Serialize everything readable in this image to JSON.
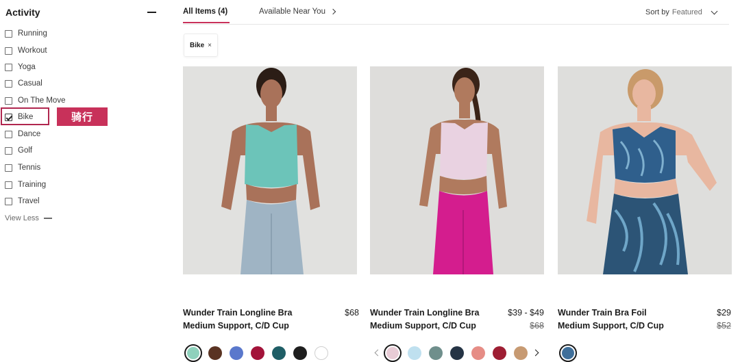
{
  "sidebar": {
    "title": "Activity",
    "filters": [
      {
        "label": "Running",
        "checked": false
      },
      {
        "label": "Workout",
        "checked": false
      },
      {
        "label": "Yoga",
        "checked": false
      },
      {
        "label": "Casual",
        "checked": false
      },
      {
        "label": "On The Move",
        "checked": false
      },
      {
        "label": "Bike",
        "checked": true
      },
      {
        "label": "Dance",
        "checked": false
      },
      {
        "label": "Golf",
        "checked": false
      },
      {
        "label": "Tennis",
        "checked": false
      },
      {
        "label": "Training",
        "checked": false
      },
      {
        "label": "Travel",
        "checked": false
      }
    ],
    "view_less": "View Less",
    "annotation": "骑行"
  },
  "tabs": {
    "all_items": "All Items (4)",
    "available_near": "Available Near You"
  },
  "sort": {
    "label": "Sort by",
    "value": "Featured"
  },
  "applied_filter": {
    "label": "Bike",
    "remove_icon": "×"
  },
  "products": [
    {
      "name_line1": "Wunder Train Longline Bra",
      "name_line2": "Medium Support, C/D Cup",
      "price": "$68",
      "old_price": "",
      "swatches": [
        "#8fd1bc",
        "#5a3322",
        "#5a78cc",
        "#a3133a",
        "#1f5e66",
        "#1e1e1e",
        "#ffffff"
      ]
    },
    {
      "name_line1": "Wunder Train Longline Bra",
      "name_line2": "Medium Support, C/D Cup",
      "price": "$39 - $49",
      "old_price": "$68",
      "swatches": [
        "#e8ccd6",
        "#bfe0ef",
        "#6f8f8c",
        "#253445",
        "#e68d86",
        "#9e1e33",
        "#c79a72"
      ]
    },
    {
      "name_line1": "Wunder Train Bra Foil",
      "name_line2": "Medium Support, C/D Cup",
      "price": "$29",
      "old_price": "$52",
      "swatches": [
        "#3f6f9a"
      ]
    }
  ],
  "colors": {
    "accent": "#c8315a",
    "highlight_border": "#b0264e"
  }
}
